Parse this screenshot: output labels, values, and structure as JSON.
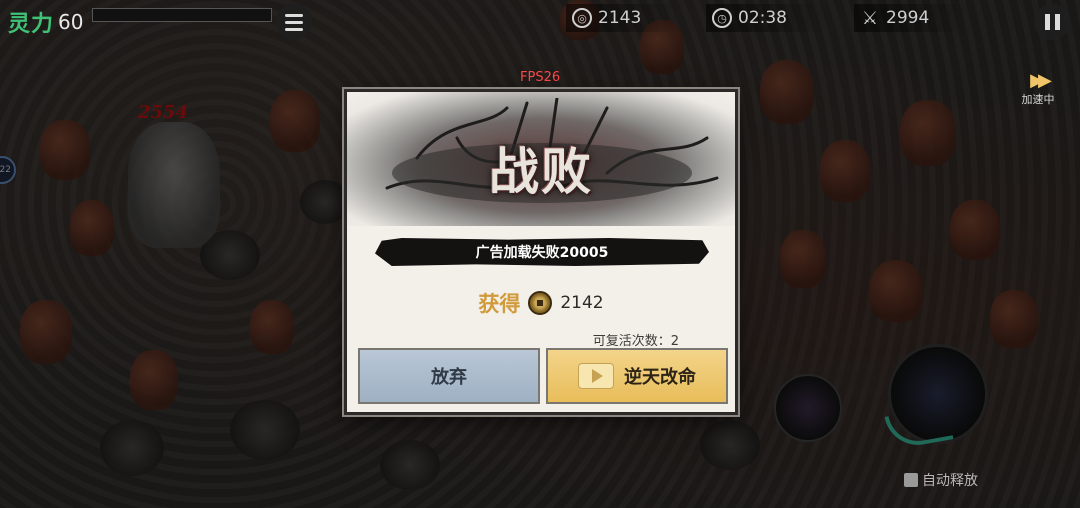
{
  "hud": {
    "spirit_label": "灵力",
    "spirit_value": "60",
    "currency_value": "2143",
    "timer_value": "02:38",
    "kill_count": "2994",
    "fps": "FPS26",
    "speed_label": "加速中",
    "damage_popup": "2554",
    "badge_value": "22",
    "auto_release_label": "自动释放"
  },
  "dialog": {
    "title": "战败",
    "message": "广告加载失败20005",
    "reward_label": "获得",
    "reward_value": "2142",
    "revive_count": "可复活次数：2",
    "give_up_label": "放弃",
    "revive_label": "逆天改命"
  },
  "colors": {
    "spirit_green": "#3fc276",
    "fps_red": "#ff4a4a",
    "reward_gold": "#d19a3d",
    "give_up_blue": "#b9c7d6",
    "revive_gold": "#f3d48a",
    "damage_red": "#c01515"
  }
}
